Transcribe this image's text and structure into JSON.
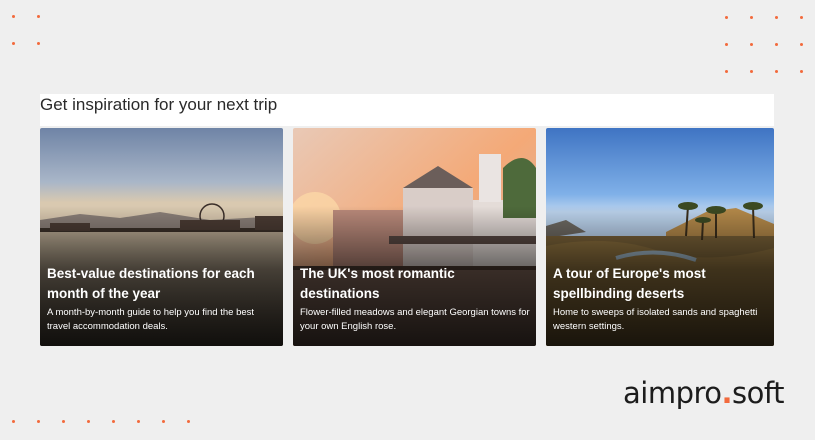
{
  "section": {
    "heading": "Get inspiration for your next trip"
  },
  "cards": [
    {
      "title": "Best-value destinations for each month of the year",
      "description": "A month-by-month guide to help you find the best travel accommodation deals."
    },
    {
      "title": "The UK's most romantic destinations",
      "description": "Flower-filled meadows and elegant Georgian towns for your own English rose."
    },
    {
      "title": "A tour of Europe's most spellbinding deserts",
      "description": "Home to sweeps of isolated sands and spaghetti western settings."
    }
  ],
  "brand": {
    "name_left": "aimpro",
    "separator": ".",
    "name_right": "soft"
  },
  "colors": {
    "accent": "#f26a3d",
    "background": "#efefef"
  }
}
